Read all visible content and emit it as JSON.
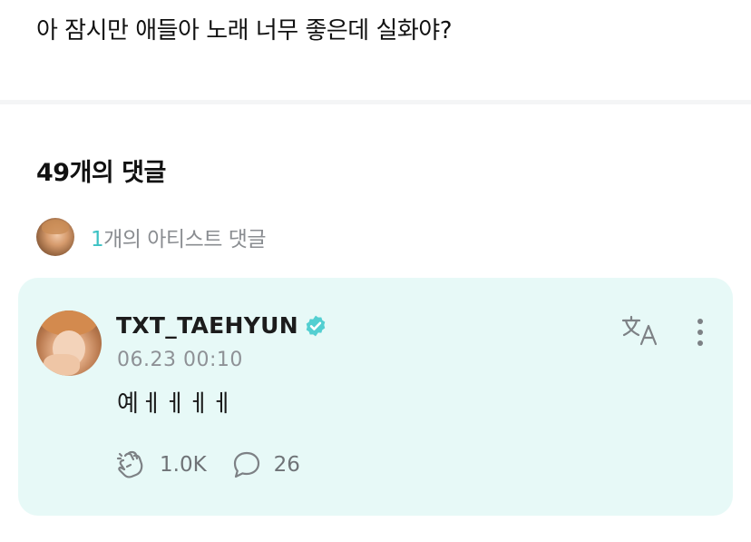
{
  "post": {
    "text": "아 잠시만 애들아 노래 너무 좋은데 실화야?"
  },
  "comments": {
    "count_label": "49개의 댓글",
    "artist_summary": {
      "count": "1",
      "label": "개의 아티스트 댓글"
    }
  },
  "artist_comment": {
    "username": "TXT_TAEHYUN",
    "verified": true,
    "timestamp": "06.23 00:10",
    "body": "예ㅔㅔㅔㅔ",
    "likes": "1.0K",
    "replies": "26"
  },
  "colors": {
    "accent": "#3cc2c4",
    "card_background": "#e7f9f7",
    "icon_gray": "#7d8185"
  },
  "icons": {
    "verified": "verified-check-icon",
    "translate": "translate-icon",
    "more": "more-vertical-icon",
    "like": "cheer-hand-icon",
    "reply": "speech-bubble-icon"
  }
}
